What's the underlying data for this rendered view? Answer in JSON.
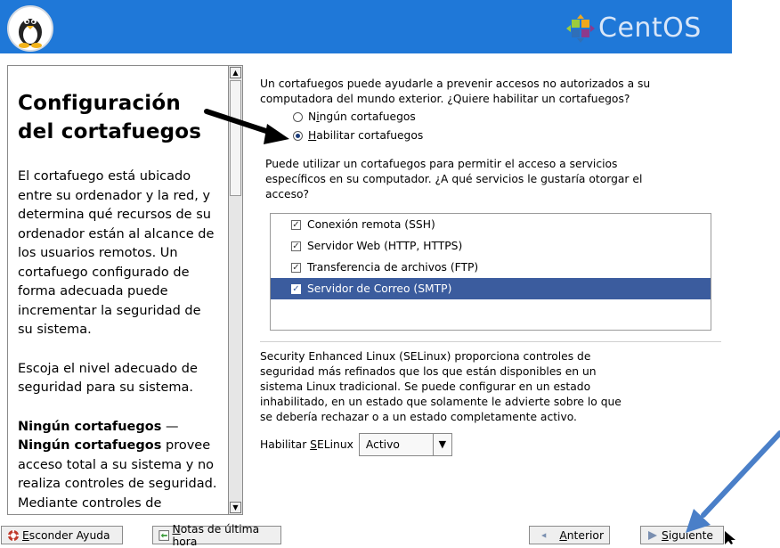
{
  "header": {
    "brand": "CentOS"
  },
  "help": {
    "title": "Configuración del cortafuegos",
    "paragraph1": "El cortafuego está ubicado entre su ordenador y la red, y determina qué recursos de su ordenador están al alcance de los usuarios remotos. Un cortafuego configurado de forma adecuada puede incrementar la seguridad de su sistema.",
    "paragraph2": "Escoja el nivel adecuado de seguridad para su sistema.",
    "paragraph3_strong": "Ningún cortafuegos",
    "paragraph3_dash": " — ",
    "paragraph3_strong2": "Ningún cortafuegos",
    "paragraph3_rest": " provee acceso total a su sistema y no realiza controles de seguridad. Mediante controles de seguridad se inhabilita el acceso a determinados"
  },
  "firewall": {
    "question": "Un cortafuegos puede ayudarle a prevenir accesos no autorizados a su computadora del mundo exterior. ¿Quiere habilitar un cortafuegos?",
    "option_none_pre": "N",
    "option_none_ul": "i",
    "option_none_post": "ngún cortafuegos",
    "option_enable_ul": "H",
    "option_enable_post": "abilitar cortafuegos",
    "selected": "enable"
  },
  "services": {
    "description": "Puede utilizar un cortafuegos para permitir el acceso a servicios específicos en su computador. ¿A qué servicios le gustaría otorgar el acceso?",
    "items": [
      {
        "label": "Conexión remota (SSH)",
        "checked": true,
        "selected": false
      },
      {
        "label": "Servidor Web (HTTP, HTTPS)",
        "checked": true,
        "selected": false
      },
      {
        "label": "Transferencia de archivos (FTP)",
        "checked": true,
        "selected": false
      },
      {
        "label": "Servidor de Correo (SMTP)",
        "checked": true,
        "selected": true
      }
    ]
  },
  "selinux": {
    "description": "Security Enhanced Linux (SELinux) proporciona controles de seguridad más refinados que los que están disponibles en un sistema Linux tradicional. Se puede configurar en un estado inhabilitado, en un estado que solamente le advierte sobre lo que se debería rechazar o a un estado completamente activo.",
    "label_pre": "Habilitar ",
    "label_ul": "S",
    "label_post": "ELinux",
    "value": "Activo"
  },
  "buttons": {
    "help_ul": "E",
    "help_post": "sconder Ayuda",
    "notes_ul": "N",
    "notes_post": "otas de última hora",
    "back_ul": "A",
    "back_post": "nterior",
    "next_ul": "S",
    "next_post": "iguiente"
  },
  "colors": {
    "header": "#1f78d8",
    "selection": "#3b5c9e",
    "annotation_arrow_black": "#000000",
    "annotation_arrow_blue": "#4a7fc8"
  }
}
